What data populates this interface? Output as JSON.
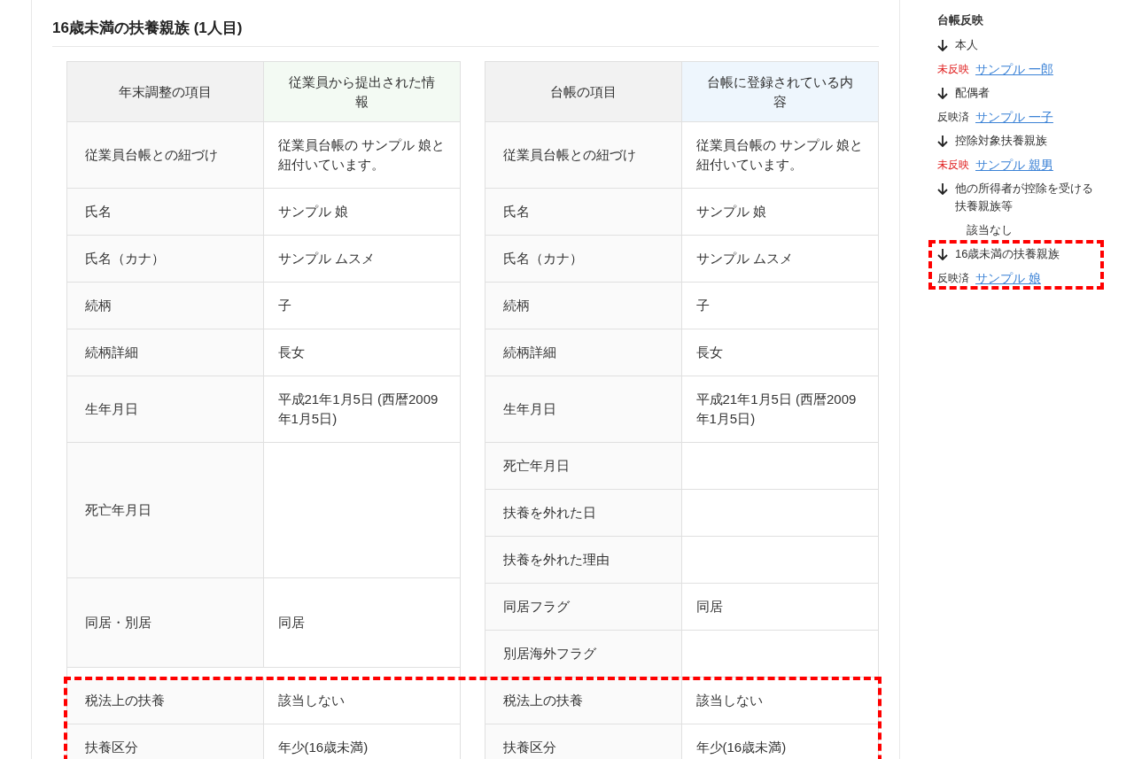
{
  "title": "16歳未満の扶養親族 (1人目)",
  "comparison": {
    "left_headers": [
      "年末調整の項目",
      "従業員から提出された情報"
    ],
    "right_headers": [
      "台帳の項目",
      "台帳に登録されている内容"
    ],
    "sections": [
      {
        "highlighted": false,
        "left_rows": [
          {
            "kind": "row",
            "label": "従業員台帳との紐づけ",
            "value": "従業員台帳の サンプル 娘と紐付いています。"
          },
          {
            "kind": "row",
            "label": "氏名",
            "value": "サンプル 娘"
          },
          {
            "kind": "row",
            "label": "氏名（カナ）",
            "value": "サンプル ムスメ"
          },
          {
            "kind": "row",
            "label": "続柄",
            "value": "子"
          },
          {
            "kind": "row",
            "label": "続柄詳細",
            "value": "長女"
          },
          {
            "kind": "row",
            "label": "生年月日",
            "value": "平成21年1月5日 (西暦2009年1月5日)"
          },
          {
            "kind": "triple",
            "label": "死亡年月日",
            "value": ""
          },
          {
            "kind": "double",
            "label": "同居・別居",
            "value": "同居"
          }
        ],
        "right_rows": [
          {
            "kind": "row",
            "label": "従業員台帳との紐づけ",
            "value": "従業員台帳の サンプル 娘と紐付いています。"
          },
          {
            "kind": "row",
            "label": "氏名",
            "value": "サンプル 娘"
          },
          {
            "kind": "row",
            "label": "氏名（カナ）",
            "value": "サンプル ムスメ"
          },
          {
            "kind": "row",
            "label": "続柄",
            "value": "子"
          },
          {
            "kind": "row",
            "label": "続柄詳細",
            "value": "長女"
          },
          {
            "kind": "row",
            "label": "生年月日",
            "value": "平成21年1月5日 (西暦2009年1月5日)"
          },
          {
            "kind": "row",
            "label": "死亡年月日",
            "value": ""
          },
          {
            "kind": "row",
            "label": "扶養を外れた日",
            "value": ""
          },
          {
            "kind": "row",
            "label": "扶養を外れた理由",
            "value": ""
          },
          {
            "kind": "row",
            "label": "同居フラグ",
            "value": "同居"
          },
          {
            "kind": "row",
            "label": "別居海外フラグ",
            "value": ""
          }
        ]
      },
      {
        "highlighted": true,
        "left_rows": [
          {
            "kind": "row",
            "label": "税法上の扶養",
            "value": "該当しない"
          },
          {
            "kind": "row",
            "label": "扶養区分",
            "value": "年少(16歳未満)"
          }
        ],
        "right_rows": [
          {
            "kind": "row",
            "label": "税法上の扶養",
            "value": "該当しない"
          },
          {
            "kind": "row",
            "label": "扶養区分",
            "value": "年少(16歳未満)"
          }
        ]
      }
    ]
  },
  "sidebar": {
    "title": "台帳反映",
    "groups": [
      {
        "label": "本人",
        "highlighted": false,
        "kind": "link",
        "status": "未反映",
        "reflected": false,
        "link": "サンプル 一郎"
      },
      {
        "label": "配偶者",
        "highlighted": false,
        "kind": "link",
        "status": "反映済",
        "reflected": true,
        "link": "サンプル 一子"
      },
      {
        "label": "控除対象扶養親族",
        "highlighted": false,
        "kind": "link",
        "status": "未反映",
        "reflected": false,
        "link": "サンプル 親男"
      },
      {
        "label": "他の所得者が控除を受ける扶養親族等",
        "highlighted": false,
        "kind": "none",
        "note": "該当なし"
      },
      {
        "label": "16歳未満の扶養親族",
        "highlighted": true,
        "kind": "link",
        "status": "反映済",
        "reflected": true,
        "link": "サンプル 娘"
      }
    ]
  }
}
